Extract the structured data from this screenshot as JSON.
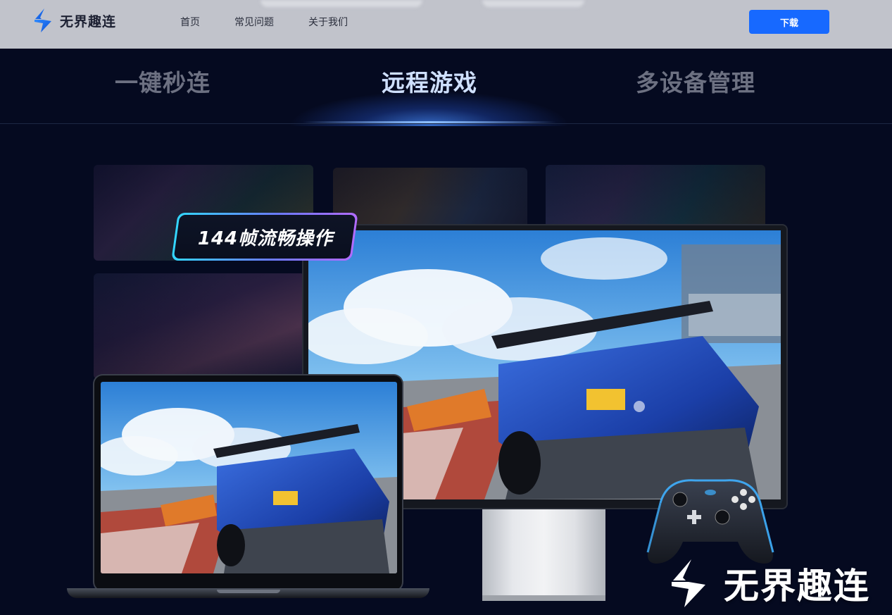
{
  "header": {
    "brand": "无界趣连",
    "nav": [
      "首页",
      "常见问题",
      "关于我们"
    ],
    "download_label": "下载",
    "download_color": "#1769ff"
  },
  "tabs": [
    {
      "label": "一键秒连",
      "active": false
    },
    {
      "label": "远程游戏",
      "active": true
    },
    {
      "label": "多设备管理",
      "active": false
    }
  ],
  "feature": {
    "badge": "144帧流畅操作"
  },
  "watermark": {
    "text": "无界趣连"
  },
  "colors": {
    "background": "#050a20",
    "accent": "#1769ff",
    "active_tab": "#cfe0ff",
    "inactive_tab": "#6d7182"
  }
}
